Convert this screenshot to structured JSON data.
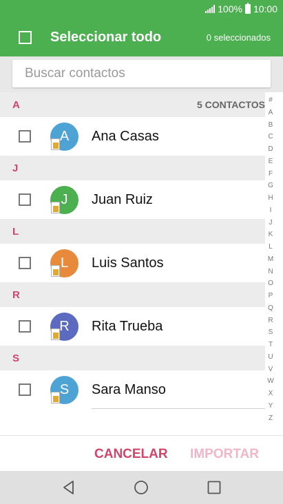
{
  "status_bar": {
    "battery_text": "100%",
    "time": "10:00"
  },
  "toolbar": {
    "title": "Seleccionar todo",
    "selected_count": "0 seleccionados"
  },
  "search": {
    "placeholder": "Buscar contactos"
  },
  "contacts_count": "5 CONTACTOS",
  "sections": [
    {
      "letter": "A",
      "contacts": [
        {
          "name": "Ana Casas",
          "initial": "A",
          "avatar_color": "#4da3d4"
        }
      ]
    },
    {
      "letter": "J",
      "contacts": [
        {
          "name": "Juan Ruiz",
          "initial": "J",
          "avatar_color": "#4caf50"
        }
      ]
    },
    {
      "letter": "L",
      "contacts": [
        {
          "name": "Luis Santos",
          "initial": "L",
          "avatar_color": "#e88a3c"
        }
      ]
    },
    {
      "letter": "R",
      "contacts": [
        {
          "name": "Rita Trueba",
          "initial": "R",
          "avatar_color": "#5c6bc0"
        }
      ]
    },
    {
      "letter": "S",
      "contacts": [
        {
          "name": "Sara Manso",
          "initial": "S",
          "avatar_color": "#4da3d4"
        }
      ]
    }
  ],
  "index_letters": [
    "#",
    "A",
    "B",
    "C",
    "D",
    "E",
    "F",
    "G",
    "H",
    "I",
    "J",
    "K",
    "L",
    "M",
    "N",
    "O",
    "P",
    "Q",
    "R",
    "S",
    "T",
    "U",
    "V",
    "W",
    "X",
    "Y",
    "Z"
  ],
  "actions": {
    "cancel_label": "CANCELAR",
    "import_label": "IMPORTAR"
  },
  "colors": {
    "primary": "#4caf50",
    "accent": "#d1456a",
    "accent_disabled": "#f0b6c7"
  },
  "icons": {
    "back": "back-triangle-icon",
    "home": "home-circle-icon",
    "recents": "recents-square-icon"
  }
}
